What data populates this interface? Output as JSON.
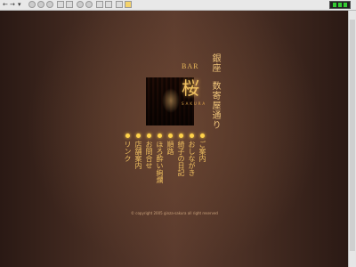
{
  "site": {
    "bar_label": "BAR",
    "logo_kanji": "桜",
    "logo_sub": "SAKURA",
    "location_lines": [
      "銀座",
      "数寄屋通り"
    ],
    "menu_items": [
      {
        "label": "ご案内"
      },
      {
        "label": "おしながき"
      },
      {
        "label": "綺子の日記"
      },
      {
        "label": "順路"
      },
      {
        "label": "ほろ酔い絢爛"
      },
      {
        "label": "お問合せ"
      },
      {
        "label": "店舗案内"
      },
      {
        "label": "リンク"
      }
    ],
    "copyright": "© copyright 2005 ginza-sakura all right reserved"
  },
  "colors": {
    "accent": "#f3c463",
    "background": "#4a2f24"
  }
}
